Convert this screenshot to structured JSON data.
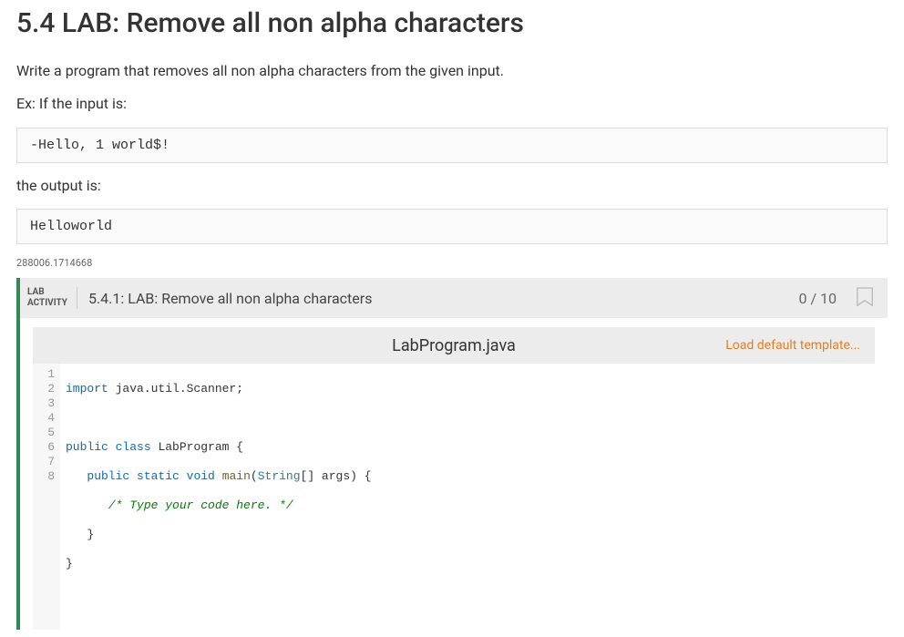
{
  "title": "5.4 LAB: Remove all non alpha characters",
  "description": "Write a program that removes all non alpha characters from the given input.",
  "example_intro": "Ex: If the input is:",
  "input_example": "-Hello, 1 world$!",
  "output_intro": "the output is:",
  "output_example": "Helloworld",
  "small_id": "288006.1714668",
  "lab": {
    "label_line1": "LAB",
    "label_line2": "ACTIVITY",
    "title": "5.4.1: LAB: Remove all non alpha characters",
    "score": "0 / 10"
  },
  "file": {
    "name": "LabProgram.java",
    "load_template": "Load default template..."
  },
  "code": {
    "line1": {
      "kw": "import",
      "rest": " java.util.Scanner;"
    },
    "line3": {
      "kw1": "public",
      "kw2": "class",
      "name": "LabProgram",
      "rest": " {"
    },
    "line4": {
      "indent": "   ",
      "kw1": "public",
      "kw2": "static",
      "kw3": "void",
      "method": "main",
      "paren_open": "(",
      "type": "String",
      "args": "[] args) {"
    },
    "line5": {
      "indent": "      ",
      "comment": "/* Type your code here. */"
    },
    "line6": {
      "indent": "   ",
      "brace": "}"
    },
    "line7": {
      "brace": "}"
    }
  },
  "line_numbers": [
    "1",
    "2",
    "3",
    "4",
    "5",
    "6",
    "7",
    "8"
  ]
}
